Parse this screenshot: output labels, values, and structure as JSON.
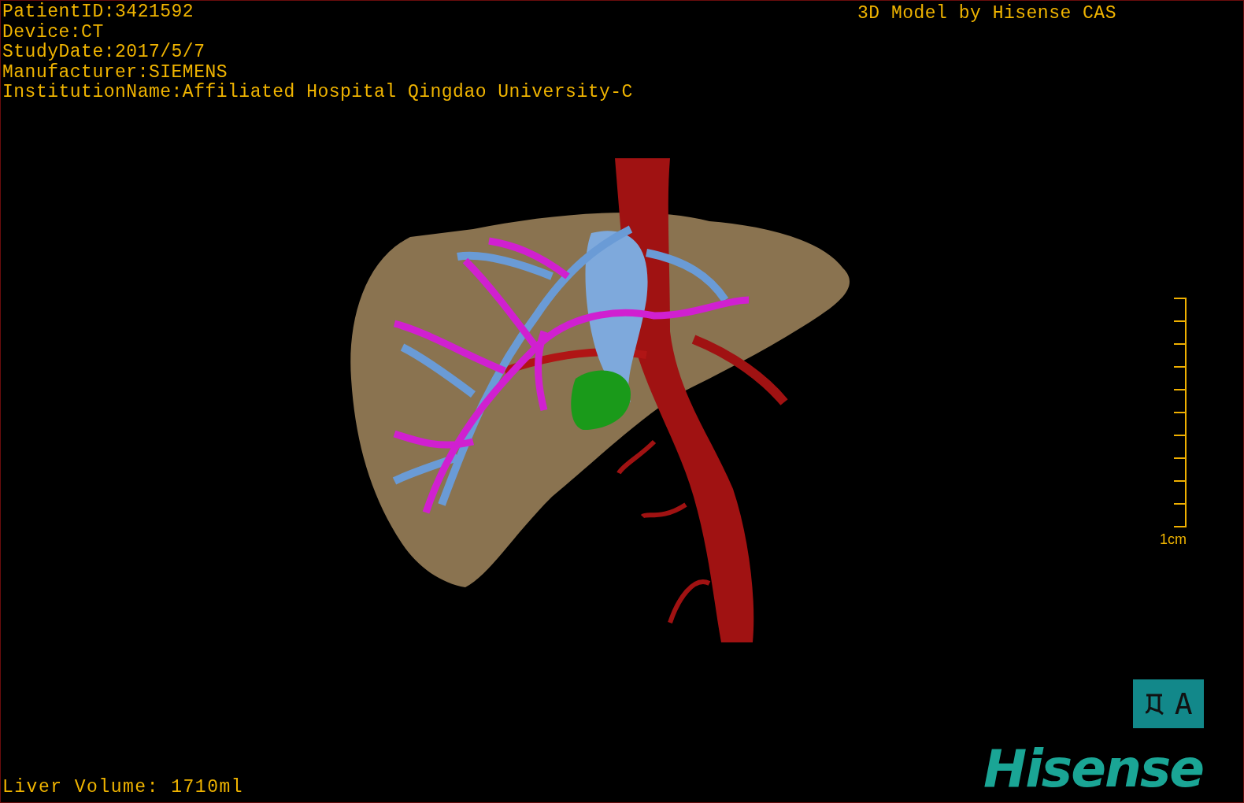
{
  "patient_info": [
    "PatientID:3421592",
    "Device:CT",
    "StudyDate:2017/5/7",
    "Manufacturer:SIEMENS",
    "InstitutionName:Affiliated Hospital Qingdao University-C"
  ],
  "model_credit": "3D Model by Hisense CAS",
  "scale_bar": {
    "label": "1cm"
  },
  "orientation_button": {
    "label": "A"
  },
  "logo": "Hisense",
  "liver_volume": "Liver Volume: 1710ml"
}
